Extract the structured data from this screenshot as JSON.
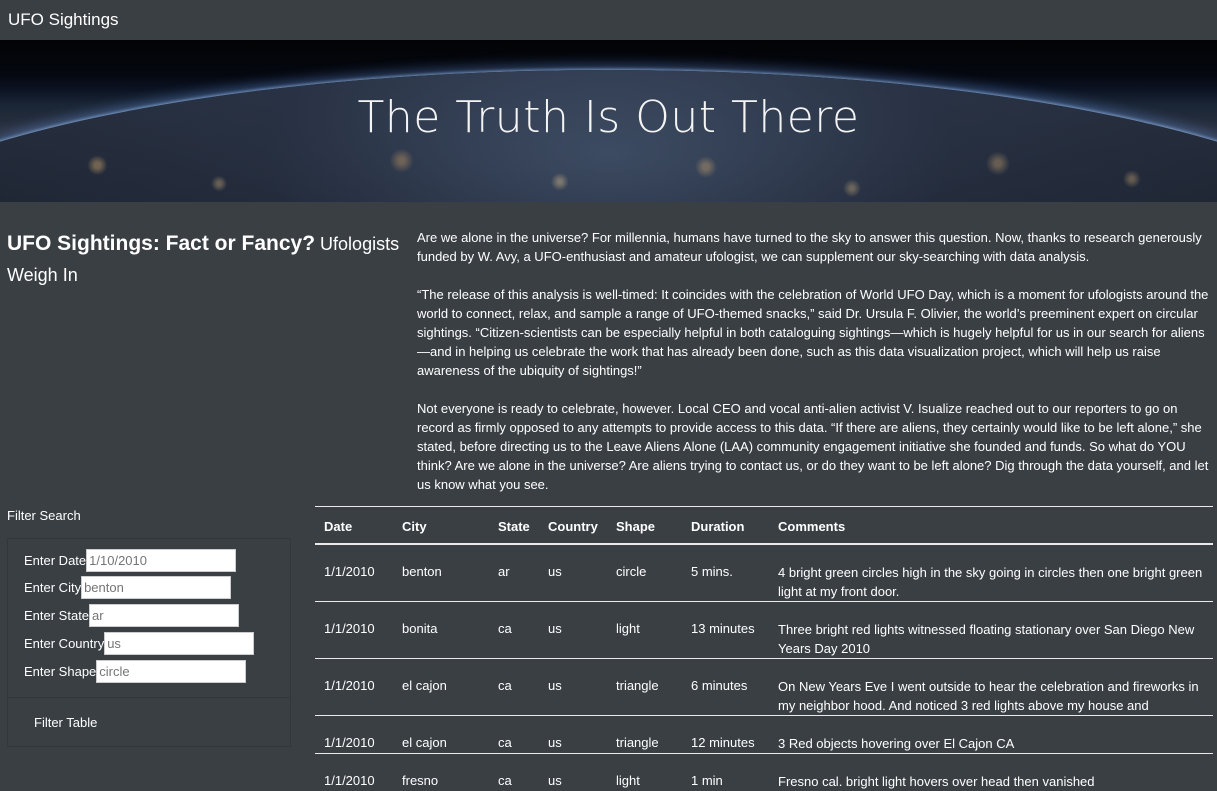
{
  "navbar": {
    "brand": "UFO Sightings"
  },
  "hero": {
    "title": "The Truth Is Out There"
  },
  "heading": {
    "main": "UFO Sightings: Fact or Fancy?",
    "sub": "Ufologists Weigh In"
  },
  "article": {
    "paragraphs": [
      "Are we alone in the universe? For millennia, humans have turned to the sky to answer this question. Now, thanks to research generously funded by W. Avy, a UFO-enthusiast and amateur ufologist, we can supplement our sky-searching with data analysis.",
      "“The release of this analysis is well-timed: It coincides with the celebration of World UFO Day, which is a moment for ufologists around the world to connect, relax, and sample a range of UFO-themed snacks,” said Dr. Ursula F. Olivier, the world’s preeminent expert on circular sightings. “Citizen-scientists can be especially helpful in both cataloguing sightings—which is hugely helpful for us in our search for aliens—and in helping us celebrate the work that has already been done, such as this data visualization project, which will help us raise awareness of the ubiquity of sightings!”",
      "Not everyone is ready to celebrate, however. Local CEO and vocal anti-alien activist V. Isualize reached out to our reporters to go on record as firmly opposed to any attempts to provide access to this data. “If there are aliens, they certainly would like to be left alone,” she stated, before directing us to the Leave Aliens Alone (LAA) community engagement initiative she founded and funds. So what do YOU think? Are we alone in the universe? Are aliens trying to contact us, or do they want to be left alone? Dig through the data yourself, and let us know what you see."
    ]
  },
  "filters": {
    "title": "Filter Search",
    "date": {
      "label": "Enter Date",
      "placeholder": "1/10/2010"
    },
    "city": {
      "label": "Enter City",
      "placeholder": "benton"
    },
    "state": {
      "label": "Enter State",
      "placeholder": "ar"
    },
    "country": {
      "label": "Enter Country",
      "placeholder": "us"
    },
    "shape": {
      "label": "Enter Shape",
      "placeholder": "circle"
    },
    "button": "Filter Table"
  },
  "table": {
    "headers": [
      "Date",
      "City",
      "State",
      "Country",
      "Shape",
      "Duration",
      "Comments"
    ],
    "rows": [
      [
        "1/1/2010",
        "benton",
        "ar",
        "us",
        "circle",
        "5 mins.",
        "4 bright green circles high in the sky going in circles then one bright green light at my front door."
      ],
      [
        "1/1/2010",
        "bonita",
        "ca",
        "us",
        "light",
        "13 minutes",
        "Three bright red lights witnessed floating stationary over San Diego New Years Day 2010"
      ],
      [
        "1/1/2010",
        "el cajon",
        "ca",
        "us",
        "triangle",
        "6 minutes",
        "On New Years Eve I went outside to hear the celebration and fireworks in my neighbor hood. And noticed 3 red lights above my house and"
      ],
      [
        "1/1/2010",
        "el cajon",
        "ca",
        "us",
        "triangle",
        "12 minutes",
        "3 Red objects hovering over El Cajon CA"
      ],
      [
        "1/1/2010",
        "fresno",
        "ca",
        "us",
        "light",
        "1 min",
        "Fresno cal. bright light hovers over head then vanished"
      ]
    ]
  }
}
